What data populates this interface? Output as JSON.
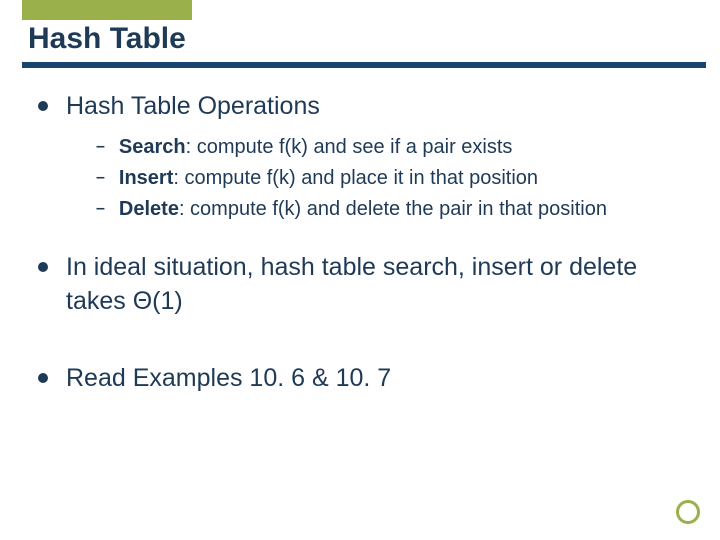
{
  "title": "Hash Table",
  "bullets": {
    "b1": "Hash Table Operations",
    "sub1": {
      "bold": "Search",
      "rest": ": compute f(k) and see if a pair exists"
    },
    "sub2": {
      "bold": "Insert",
      "rest": ": compute f(k) and place it in that position"
    },
    "sub3": {
      "bold": "Delete",
      "rest": ": compute f(k) and delete the pair in that position"
    },
    "b2": "In ideal situation, hash table search, insert or delete takes Θ(1)",
    "b3": "Read Examples 10. 6 & 10. 7"
  }
}
